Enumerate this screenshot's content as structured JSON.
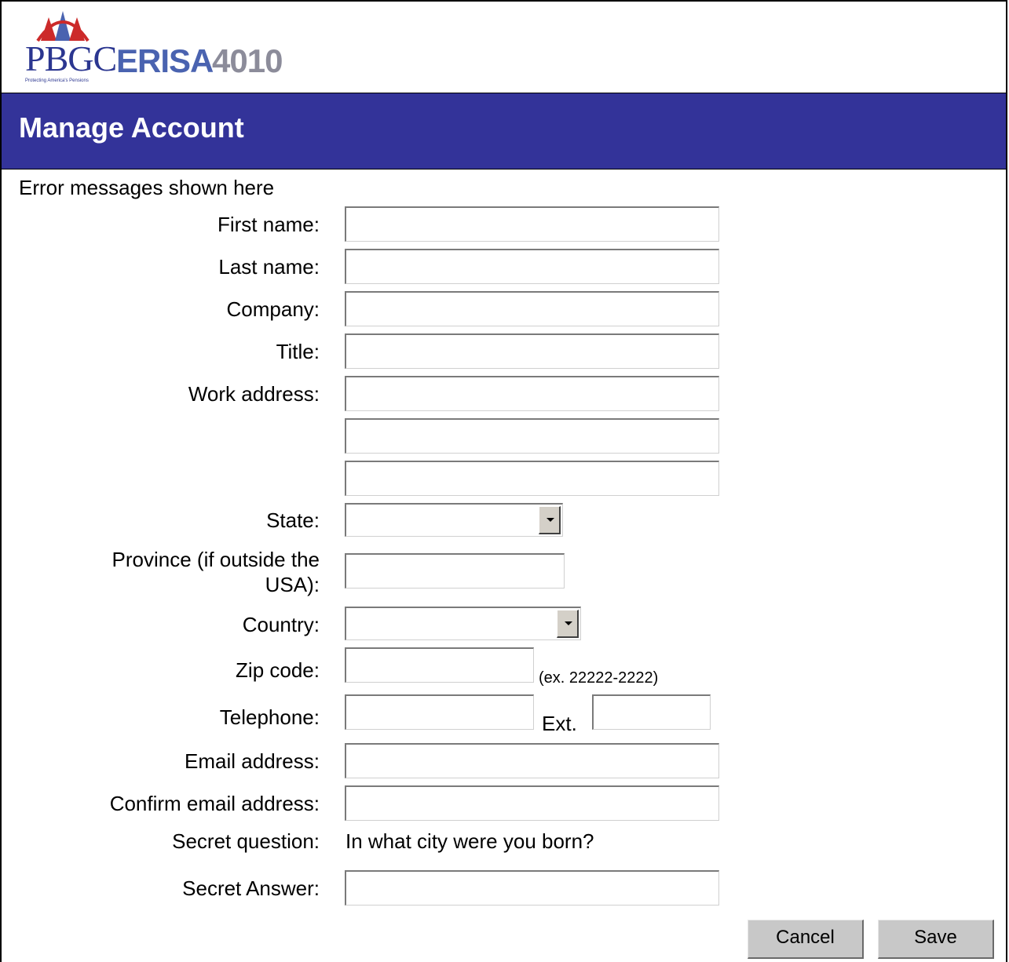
{
  "header": {
    "logo_pbgc": "PBGC",
    "logo_erisa": "ERISA",
    "logo_4010": "4010",
    "logo_tagline": "Protecting America's Pensions"
  },
  "page": {
    "title": "Manage Account",
    "error_message": "Error messages shown here"
  },
  "form": {
    "first_name_label": "First name:",
    "last_name_label": "Last name:",
    "company_label": "Company:",
    "title_label": "Title:",
    "work_address_label": "Work address:",
    "state_label": "State:",
    "province_label": "Province (if outside the USA):",
    "country_label": "Country:",
    "zip_label": "Zip code:",
    "zip_hint": "(ex. 22222-2222)",
    "telephone_label": "Telephone:",
    "ext_label": "Ext.",
    "email_label": "Email address:",
    "confirm_email_label": "Confirm email address:",
    "secret_question_label": "Secret question:",
    "secret_question_value": "In what city were you born?",
    "secret_answer_label": "Secret Answer:"
  },
  "buttons": {
    "cancel": "Cancel",
    "save": "Save"
  },
  "colors": {
    "title_bar": "#333399",
    "logo_blue": "#2b3690",
    "logo_red": "#cc2a2a"
  }
}
